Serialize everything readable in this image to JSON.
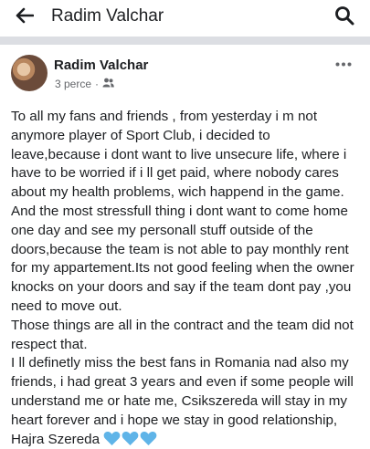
{
  "header": {
    "title": "Radim Valchar",
    "back_icon": "arrow-left-icon",
    "search_icon": "search-icon"
  },
  "post": {
    "author": "Radim Valchar",
    "time": "3 perce",
    "separator": "·",
    "audience_icon": "friends-icon",
    "more_icon": "more-horizontal-icon",
    "paragraphs": [
      "To all my fans and friends , from yesterday i m  not anymore player of Sport Club, i decided to leave,because i dont want to live unsecure life, where i have to be worried if i ll get paid, where  nobody cares about my health problems, wich happend in the game. And the most stressfull thing i dont want to come home one day and see my personall stuff outside of the doors,because the team is not able to pay monthly rent for my appartement.Its not good feeling when the owner knocks on your doors and say if the team dont pay ,you need to move out.",
      "Those things are all in the contract and the team did not respect that.",
      "I ll definetly miss the best fans in Romania nad also my friends, i had great 3 years and even if some people will understand me or hate me, Csikszereda will stay in my heart forever and i hope we stay in good relationship, Hajra Szereda"
    ],
    "emoji": [
      "blue-heart-icon",
      "blue-heart-icon",
      "blue-heart-icon"
    ]
  },
  "colors": {
    "text": "#1c1e21",
    "secondary_text": "#65676b",
    "divider": "#dcdee3",
    "heart": "#5fb4e8"
  }
}
